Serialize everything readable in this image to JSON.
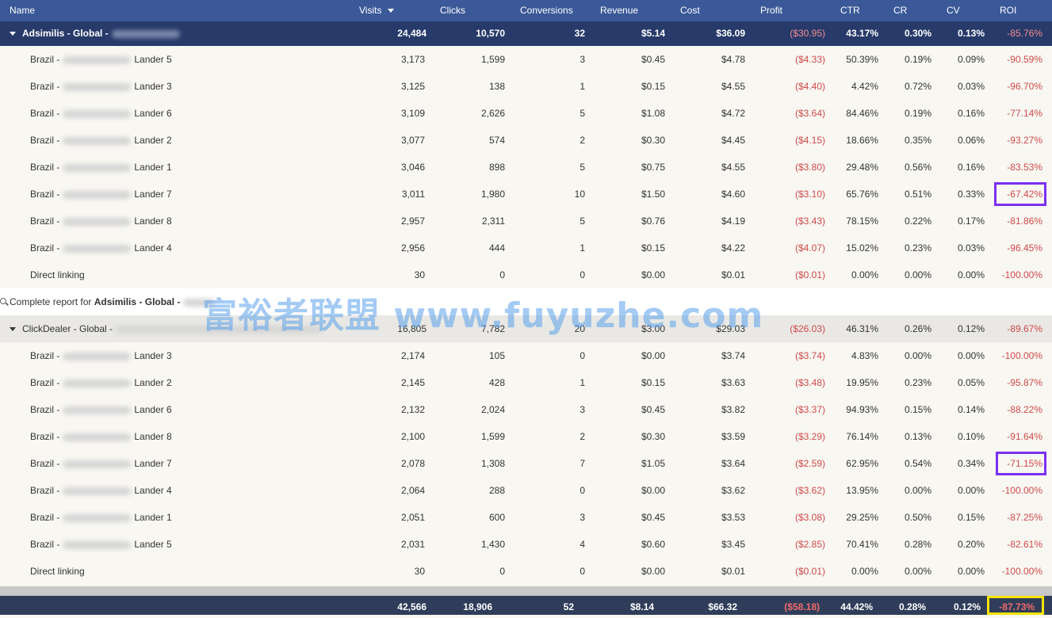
{
  "headers": {
    "name": "Name",
    "visits": "Visits",
    "clicks": "Clicks",
    "conversions": "Conversions",
    "revenue": "Revenue",
    "cost": "Cost",
    "profit": "Profit",
    "ctr": "CTR",
    "cr": "CR",
    "cv": "CV",
    "roi": "ROI"
  },
  "group1": {
    "name": "Adsimilis - Global -",
    "totals": {
      "visits": "24,484",
      "clicks": "10,570",
      "conversions": "32",
      "revenue": "$5.14",
      "cost": "$36.09",
      "profit": "($30.95)",
      "ctr": "43.17%",
      "cr": "0.30%",
      "cv": "0.13%",
      "roi": "-85.76%"
    },
    "rows": [
      {
        "prefix": "Brazil -",
        "lander": "Lander 5",
        "visits": "3,173",
        "clicks": "1,599",
        "conversions": "3",
        "revenue": "$0.45",
        "cost": "$4.78",
        "profit": "($4.33)",
        "ctr": "50.39%",
        "cr": "0.19%",
        "cv": "0.09%",
        "roi": "-90.59%"
      },
      {
        "prefix": "Brazil -",
        "lander": "Lander 3",
        "visits": "3,125",
        "clicks": "138",
        "conversions": "1",
        "revenue": "$0.15",
        "cost": "$4.55",
        "profit": "($4.40)",
        "ctr": "4.42%",
        "cr": "0.72%",
        "cv": "0.03%",
        "roi": "-96.70%"
      },
      {
        "prefix": "Brazil -",
        "lander": "Lander 6",
        "visits": "3,109",
        "clicks": "2,626",
        "conversions": "5",
        "revenue": "$1.08",
        "cost": "$4.72",
        "profit": "($3.64)",
        "ctr": "84.46%",
        "cr": "0.19%",
        "cv": "0.16%",
        "roi": "-77.14%"
      },
      {
        "prefix": "Brazil -",
        "lander": "Lander 2",
        "visits": "3,077",
        "clicks": "574",
        "conversions": "2",
        "revenue": "$0.30",
        "cost": "$4.45",
        "profit": "($4.15)",
        "ctr": "18.66%",
        "cr": "0.35%",
        "cv": "0.06%",
        "roi": "-93.27%"
      },
      {
        "prefix": "Brazil -",
        "lander": "Lander 1",
        "visits": "3,046",
        "clicks": "898",
        "conversions": "5",
        "revenue": "$0.75",
        "cost": "$4.55",
        "profit": "($3.80)",
        "ctr": "29.48%",
        "cr": "0.56%",
        "cv": "0.16%",
        "roi": "-83.53%"
      },
      {
        "prefix": "Brazil -",
        "lander": "Lander 7",
        "visits": "3,011",
        "clicks": "1,980",
        "conversions": "10",
        "revenue": "$1.50",
        "cost": "$4.60",
        "profit": "($3.10)",
        "ctr": "65.76%",
        "cr": "0.51%",
        "cv": "0.33%",
        "roi": "-67.42%"
      },
      {
        "prefix": "Brazil -",
        "lander": "Lander 8",
        "visits": "2,957",
        "clicks": "2,311",
        "conversions": "5",
        "revenue": "$0.76",
        "cost": "$4.19",
        "profit": "($3.43)",
        "ctr": "78.15%",
        "cr": "0.22%",
        "cv": "0.17%",
        "roi": "-81.86%"
      },
      {
        "prefix": "Brazil -",
        "lander": "Lander 4",
        "visits": "2,956",
        "clicks": "444",
        "conversions": "1",
        "revenue": "$0.15",
        "cost": "$4.22",
        "profit": "($4.07)",
        "ctr": "15.02%",
        "cr": "0.23%",
        "cv": "0.03%",
        "roi": "-96.45%"
      },
      {
        "prefix": "Direct linking",
        "lander": "",
        "visits": "30",
        "clicks": "0",
        "conversions": "0",
        "revenue": "$0.00",
        "cost": "$0.01",
        "profit": "($0.01)",
        "ctr": "0.00%",
        "cr": "0.00%",
        "cv": "0.00%",
        "roi": "-100.00%"
      }
    ]
  },
  "report_link": {
    "prefix": "Complete report for ",
    "bold": "Adsimilis - Global -"
  },
  "group2": {
    "name": "ClickDealer - Global -",
    "totals": {
      "visits": "16,805",
      "clicks": "7,782",
      "conversions": "20",
      "revenue": "$3.00",
      "cost": "$29.03",
      "profit": "($26.03)",
      "ctr": "46.31%",
      "cr": "0.26%",
      "cv": "0.12%",
      "roi": "-89.67%"
    },
    "rows": [
      {
        "prefix": "Brazil -",
        "lander": "Lander 3",
        "visits": "2,174",
        "clicks": "105",
        "conversions": "0",
        "revenue": "$0.00",
        "cost": "$3.74",
        "profit": "($3.74)",
        "ctr": "4.83%",
        "cr": "0.00%",
        "cv": "0.00%",
        "roi": "-100.00%"
      },
      {
        "prefix": "Brazil -",
        "lander": "Lander 2",
        "visits": "2,145",
        "clicks": "428",
        "conversions": "1",
        "revenue": "$0.15",
        "cost": "$3.63",
        "profit": "($3.48)",
        "ctr": "19.95%",
        "cr": "0.23%",
        "cv": "0.05%",
        "roi": "-95.87%"
      },
      {
        "prefix": "Brazil -",
        "lander": "Lander 6",
        "visits": "2,132",
        "clicks": "2,024",
        "conversions": "3",
        "revenue": "$0.45",
        "cost": "$3.82",
        "profit": "($3.37)",
        "ctr": "94.93%",
        "cr": "0.15%",
        "cv": "0.14%",
        "roi": "-88.22%"
      },
      {
        "prefix": "Brazil -",
        "lander": "Lander 8",
        "visits": "2,100",
        "clicks": "1,599",
        "conversions": "2",
        "revenue": "$0.30",
        "cost": "$3.59",
        "profit": "($3.29)",
        "ctr": "76.14%",
        "cr": "0.13%",
        "cv": "0.10%",
        "roi": "-91.64%"
      },
      {
        "prefix": "Brazil -",
        "lander": "Lander 7",
        "visits": "2,078",
        "clicks": "1,308",
        "conversions": "7",
        "revenue": "$1.05",
        "cost": "$3.64",
        "profit": "($2.59)",
        "ctr": "62.95%",
        "cr": "0.54%",
        "cv": "0.34%",
        "roi": "-71.15%"
      },
      {
        "prefix": "Brazil -",
        "lander": "Lander 4",
        "visits": "2,064",
        "clicks": "288",
        "conversions": "0",
        "revenue": "$0.00",
        "cost": "$3.62",
        "profit": "($3.62)",
        "ctr": "13.95%",
        "cr": "0.00%",
        "cv": "0.00%",
        "roi": "-100.00%"
      },
      {
        "prefix": "Brazil -",
        "lander": "Lander 1",
        "visits": "2,051",
        "clicks": "600",
        "conversions": "3",
        "revenue": "$0.45",
        "cost": "$3.53",
        "profit": "($3.08)",
        "ctr": "29.25%",
        "cr": "0.50%",
        "cv": "0.15%",
        "roi": "-87.25%"
      },
      {
        "prefix": "Brazil -",
        "lander": "Lander 5",
        "visits": "2,031",
        "clicks": "1,430",
        "conversions": "4",
        "revenue": "$0.60",
        "cost": "$3.45",
        "profit": "($2.85)",
        "ctr": "70.41%",
        "cr": "0.28%",
        "cv": "0.20%",
        "roi": "-82.61%"
      },
      {
        "prefix": "Direct linking",
        "lander": "",
        "visits": "30",
        "clicks": "0",
        "conversions": "0",
        "revenue": "$0.00",
        "cost": "$0.01",
        "profit": "($0.01)",
        "ctr": "0.00%",
        "cr": "0.00%",
        "cv": "0.00%",
        "roi": "-100.00%"
      }
    ]
  },
  "grand_total": {
    "visits": "42,566",
    "clicks": "18,906",
    "conversions": "52",
    "revenue": "$8.14",
    "cost": "$66.32",
    "profit": "($58.18)",
    "ctr": "44.42%",
    "cr": "0.28%",
    "cv": "0.12%",
    "roi": "-87.73%"
  },
  "watermark": "富裕者联盟 www.fuyuzhe.com",
  "colors": {
    "header": "#3b5998",
    "group_dark": "#273a6a",
    "negative": "#cf4a4a",
    "highlight_purple": "#7b2ff2",
    "highlight_yellow": "#f5e400"
  }
}
